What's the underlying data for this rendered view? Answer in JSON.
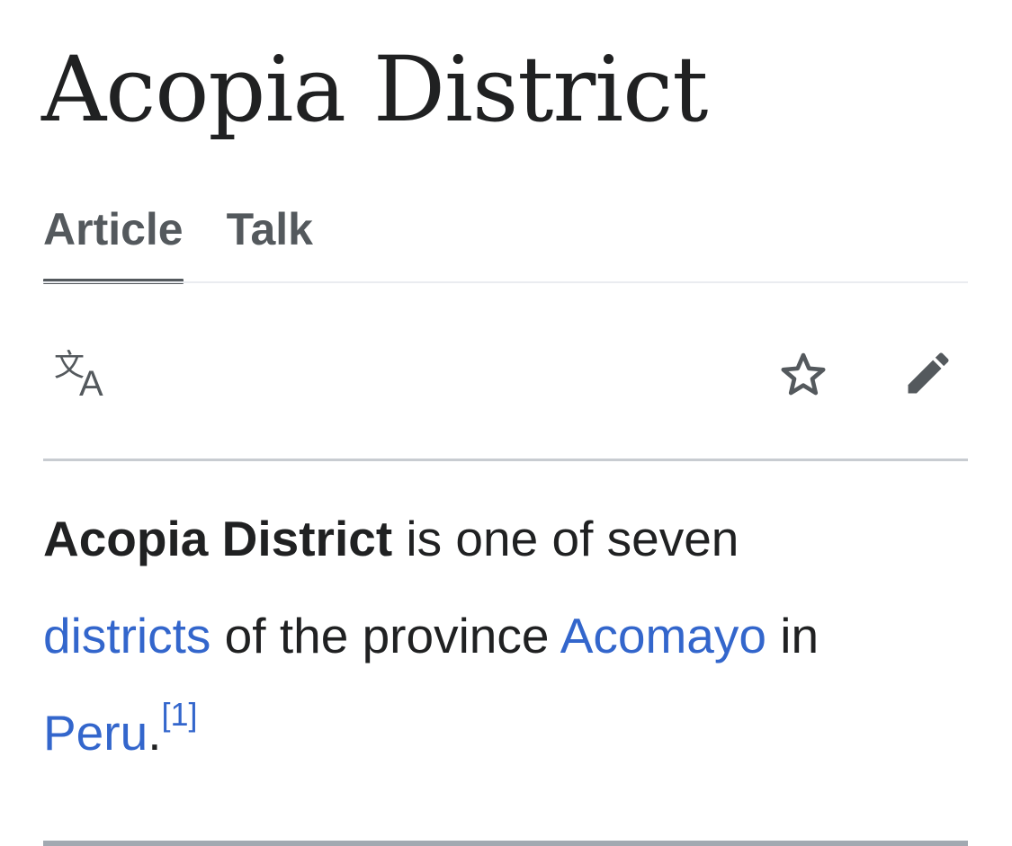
{
  "page": {
    "title": "Acopia District"
  },
  "tabs": [
    {
      "label": "Article",
      "selected": true
    },
    {
      "label": "Talk",
      "selected": false
    }
  ],
  "toolbar": {
    "language_icon": "translate-icon",
    "watch_icon": "star-outline-icon",
    "edit_icon": "pencil-icon"
  },
  "lead": {
    "subject": "Acopia District",
    "text_1": " is one of seven ",
    "link_districts": "districts",
    "text_2": " of the province ",
    "link_acomayo": "Acomayo",
    "text_3": " in ",
    "link_peru": "Peru",
    "text_4": ".",
    "citation": "[1]"
  },
  "colors": {
    "text": "#202122",
    "link": "#3366cc",
    "tab_text": "#54595d",
    "icon": "#54595d",
    "divider": "#c8ccd1"
  }
}
